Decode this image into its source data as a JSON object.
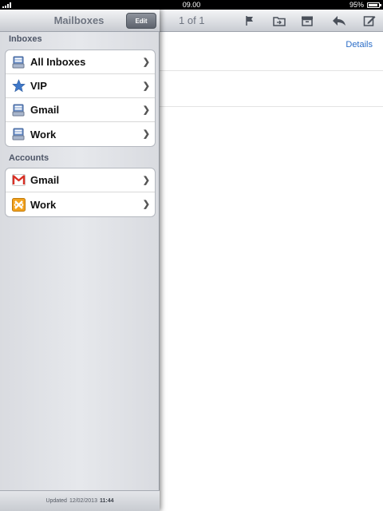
{
  "status_bar": {
    "time": "09.00",
    "battery_text": "95%",
    "battery_level": 0.95
  },
  "mailboxes_panel": {
    "title": "Mailboxes",
    "edit_label": "Edit",
    "inboxes_section": {
      "label": "Inboxes",
      "items": [
        {
          "label": "All Inboxes",
          "icon": "inbox-tray-icon"
        },
        {
          "label": "VIP",
          "icon": "star-icon"
        },
        {
          "label": "Gmail",
          "icon": "inbox-tray-icon"
        },
        {
          "label": "Work",
          "icon": "inbox-tray-icon"
        }
      ]
    },
    "accounts_section": {
      "label": "Accounts",
      "items": [
        {
          "label": "Gmail",
          "icon": "gmail-icon"
        },
        {
          "label": "Work",
          "icon": "exchange-icon"
        }
      ]
    },
    "footer": {
      "updated_label": "Updated",
      "date": "12/02/2013",
      "time": "11:44"
    }
  },
  "message_toolbar": {
    "pager": "1 of 1",
    "icons": [
      "flag-icon",
      "move-folder-icon",
      "archive-icon",
      "reply-icon",
      "compose-icon"
    ]
  },
  "message_view": {
    "details_link": "Details"
  },
  "colors": {
    "link": "#2b6dc7",
    "gmail_red": "#d93025",
    "exchange_orange": "#f2a21e",
    "vip_star": "#3f78c8"
  }
}
